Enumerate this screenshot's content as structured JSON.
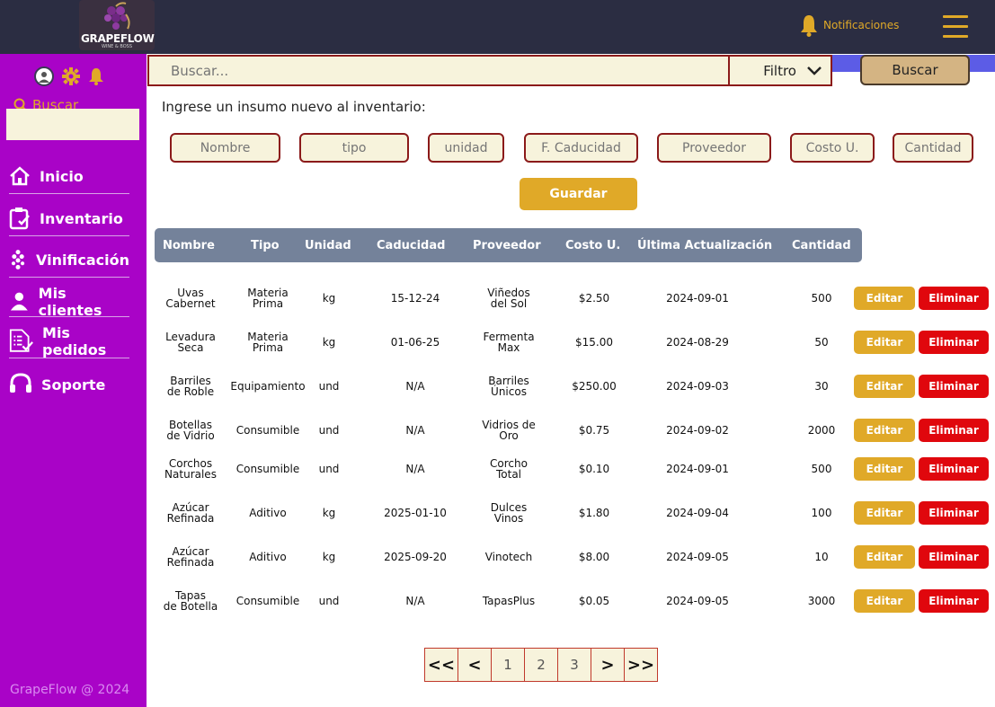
{
  "header": {
    "logo_text": "GRAPEFLOW",
    "logo_sub": "WINE & BOSS",
    "notifications_label": "Notificaciones"
  },
  "sidebar": {
    "search_label": "Buscar",
    "items": [
      {
        "label": "Inicio",
        "icon": "home-icon"
      },
      {
        "label": "Inventario",
        "icon": "clipboard-icon"
      },
      {
        "label": "Vinificación",
        "icon": "grapes-icon"
      },
      {
        "label": "Mis clientes",
        "icon": "user-icon"
      },
      {
        "label": "Mis pedidos",
        "icon": "list-icon"
      },
      {
        "label": "Soporte",
        "icon": "headset-icon"
      }
    ],
    "footer": "GrapeFlow  @ 2024"
  },
  "search": {
    "placeholder": "Buscar...",
    "filter_label": "Filtro",
    "button_label": "Buscar"
  },
  "form": {
    "title": "Ingrese un insumo nuevo al inventario:",
    "fields": {
      "nombre": "Nombre",
      "tipo": "tipo",
      "unidad": "unidad",
      "caducidad": "F. Caducidad",
      "proveedor": "Proveedor",
      "costo": "Costo U.",
      "cantidad": "Cantidad"
    },
    "save_label": "Guardar"
  },
  "table": {
    "headers": [
      "Nombre",
      "Tipo",
      "Unidad",
      "Caducidad",
      "Proveedor",
      "Costo U.",
      "Última Actualización",
      "Cantidad"
    ],
    "edit_label": "Editar",
    "delete_label": "Eliminar",
    "rows": [
      {
        "nombre1": "Uvas",
        "nombre2": "Cabernet",
        "tipo1": "Materia",
        "tipo2": "Prima",
        "unidad": "kg",
        "caducidad": "15-12-24",
        "prov1": "Viñedos",
        "prov2": "del Sol",
        "costo": "$2.50",
        "actualizacion": "2024-09-01",
        "cantidad": "500"
      },
      {
        "nombre1": "Levadura",
        "nombre2": "Seca",
        "tipo1": "Materia",
        "tipo2": "Prima",
        "unidad": "kg",
        "caducidad": "01-06-25",
        "prov1": "Fermenta",
        "prov2": "Max",
        "costo": "$15.00",
        "actualizacion": "2024-08-29",
        "cantidad": "50"
      },
      {
        "nombre1": "Barriles",
        "nombre2": "de Roble",
        "tipo1": "Equipamiento",
        "tipo2": "",
        "unidad": "und",
        "caducidad": "N/A",
        "prov1": "Barriles",
        "prov2": "Únicos",
        "costo": "$250.00",
        "actualizacion": "2024-09-03",
        "cantidad": "30"
      },
      {
        "nombre1": "Botellas",
        "nombre2": "de Vidrio",
        "tipo1": "Consumible",
        "tipo2": "",
        "unidad": "und",
        "caducidad": "N/A",
        "prov1": "Vidrios de",
        "prov2": "Oro",
        "costo": "$0.75",
        "actualizacion": "2024-09-02",
        "cantidad": "2000"
      },
      {
        "nombre1": "Corchos",
        "nombre2": "Naturales",
        "tipo1": "Consumible",
        "tipo2": "",
        "unidad": "und",
        "caducidad": "N/A",
        "prov1": "Corcho",
        "prov2": "Total",
        "costo": "$0.10",
        "actualizacion": "2024-09-01",
        "cantidad": "500"
      },
      {
        "nombre1": "Azúcar",
        "nombre2": "Refinada",
        "tipo1": "Aditivo",
        "tipo2": "",
        "unidad": "kg",
        "caducidad": "2025-01-10",
        "prov1": "Dulces",
        "prov2": "Vinos",
        "costo": "$1.80",
        "actualizacion": "2024-09-04",
        "cantidad": "100"
      },
      {
        "nombre1": "Azúcar",
        "nombre2": "Refinada",
        "tipo1": "Aditivo",
        "tipo2": "",
        "unidad": "kg",
        "caducidad": "2025-09-20",
        "prov1": "Vinotech",
        "prov2": "",
        "costo": "$8.00",
        "actualizacion": "2024-09-05",
        "cantidad": "10"
      },
      {
        "nombre1": "Tapas",
        "nombre2": "de Botella",
        "tipo1": "Consumible",
        "tipo2": "",
        "unidad": "und",
        "caducidad": "N/A",
        "prov1": "TapasPlus",
        "prov2": "",
        "costo": "$0.05",
        "actualizacion": "2024-09-05",
        "cantidad": "3000"
      }
    ]
  },
  "pagination": {
    "first": "<<",
    "prev": "<",
    "pages": [
      "1",
      "2",
      "3"
    ],
    "next": ">",
    "last": ">>"
  },
  "colors": {
    "topbar": "#2b2d42",
    "sidebar": "#a903c7",
    "accent": "#e0a928",
    "danger": "#e0070d",
    "input_bg": "#f7f3dc",
    "table_header": "#74829a"
  }
}
